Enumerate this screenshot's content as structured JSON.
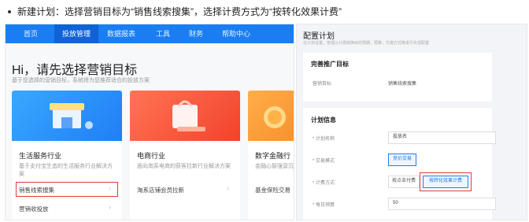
{
  "instruction": "新建计划：选择营销目标为“销售线索搜集”，选择计费方式为“按转化效果计费”",
  "nav": {
    "items": [
      "首页",
      "投放管理",
      "数据报表",
      "工具",
      "财务",
      "帮助中心"
    ],
    "active_index": 1
  },
  "main": {
    "greeting": "Hi，请先选择营销目标",
    "subtitle": "基于您选择的营销目标，系统将为您推荐适合的投放方案"
  },
  "cards": [
    {
      "title": "生活服务行业",
      "desc": "基于支付宝生态的生活服务行业解决方案",
      "items": [
        "销售线索搜集",
        "营销收投放"
      ],
      "color_from": "#34a3ff",
      "color_to": "#1f7ef5"
    },
    {
      "title": "电商行业",
      "desc": "面向淘系电商的获客拉新行业解决方案",
      "items": [
        "淘系店铺会员拉新"
      ],
      "color_from": "#ff6a4d",
      "color_to": "#f2432b"
    },
    {
      "title": "数字金融行",
      "desc": "金融心智强营沉淀方案",
      "items": [
        "基金保险交易"
      ],
      "color_from": "#ffa63d",
      "color_to": "#f27f1a"
    }
  ],
  "panel": {
    "title": "配置计划",
    "desc": "在计划设置，管理以计费转换目的预期，预算，交易方式等进行实现配置",
    "section1": {
      "title": "完善推广目标",
      "label": "营销目标",
      "value": "销售线索搜集"
    },
    "section2": {
      "title": "计划信息",
      "name_label": "* 计划名称",
      "name_value": "投放名",
      "trade_label": "* 交易模式",
      "trade_value": "竞价交易",
      "billing_label": "* 计费方式",
      "billing_options": [
        "按点击付费",
        "按转化效果计费"
      ],
      "billing_selected": 1,
      "budget_label": "* 每日预算",
      "budget_value": "50"
    }
  },
  "colors": {
    "nav_blue": "#1a7ef2",
    "highlight_red": "#e03b3b"
  }
}
